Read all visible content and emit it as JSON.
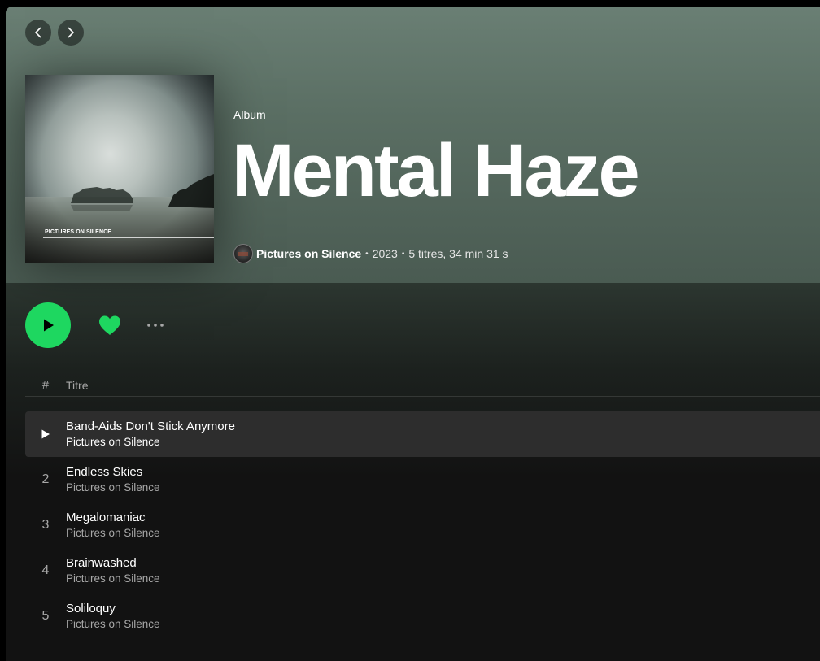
{
  "nav": {
    "back_icon": "chevron-left-icon",
    "forward_icon": "chevron-right-icon"
  },
  "album": {
    "cover_caption": "PICTURES ON SILENCE",
    "type": "Album",
    "title": "Mental Haze",
    "artist": "Pictures on Silence",
    "year": "2023",
    "summary": "5 titres, 34 min 31 s"
  },
  "controls": {
    "play_icon": "play-icon",
    "like_icon": "heart-filled-icon",
    "more_icon": "more-horizontal-icon",
    "accent_color": "#1ed760"
  },
  "table": {
    "col_number": "#",
    "col_title": "Titre"
  },
  "tracks": [
    {
      "number": "1",
      "title": "Band-Aids Don't Stick Anymore",
      "artist": "Pictures on Silence",
      "active": true
    },
    {
      "number": "2",
      "title": "Endless Skies",
      "artist": "Pictures on Silence",
      "active": false
    },
    {
      "number": "3",
      "title": "Megalomaniac",
      "artist": "Pictures on Silence",
      "active": false
    },
    {
      "number": "4",
      "title": "Brainwashed",
      "artist": "Pictures on Silence",
      "active": false
    },
    {
      "number": "5",
      "title": "Soliloquy",
      "artist": "Pictures on Silence",
      "active": false
    }
  ]
}
